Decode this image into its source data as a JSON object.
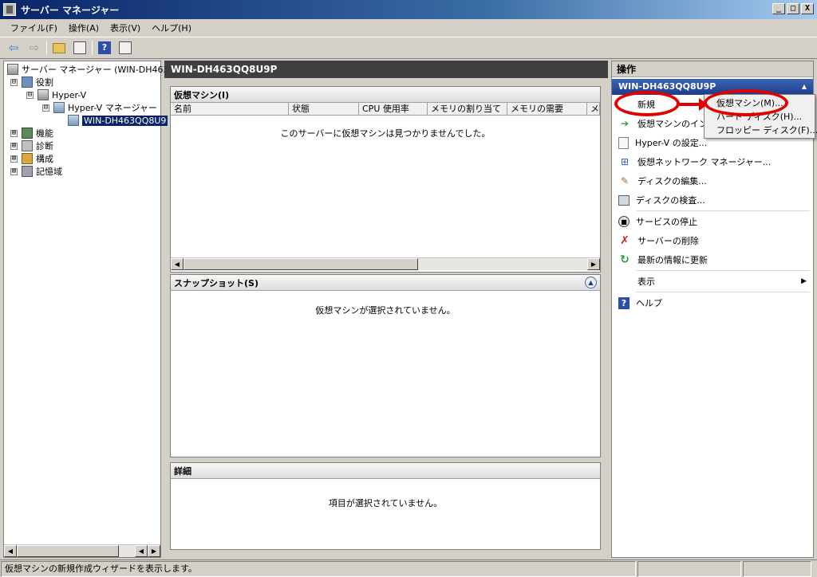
{
  "window": {
    "title": "サーバー マネージャー",
    "min_label": "_",
    "max_label": "□",
    "close_label": "X"
  },
  "menu": [
    "ファイル(F)",
    "操作(A)",
    "表示(V)",
    "ヘルプ(H)"
  ],
  "toolbar": {
    "back": "⇦",
    "forward": "⇨",
    "help": "?"
  },
  "tree": {
    "root": "サーバー マネージャー (WIN-DH463",
    "roles": "役割",
    "hyperv": "Hyper-V",
    "hyperv_manager": "Hyper-V マネージャー",
    "server": "WIN-DH463QQ8U9",
    "features": "機能",
    "diagnostics": "診断",
    "configuration": "構成",
    "storage": "記憶域",
    "expander_minus": "⊟",
    "expander_plus": "⊞"
  },
  "center": {
    "header": "WIN-DH463QQ8U9P",
    "vm_panel": {
      "title": "仮想マシン(I)",
      "columns": [
        "名前",
        "状態",
        "CPU 使用率",
        "メモリの割り当て",
        "メモリの需要",
        "メ"
      ],
      "empty": "このサーバーに仮想マシンは見つかりませんでした。"
    },
    "snapshot_panel": {
      "title": "スナップショット(S)",
      "empty": "仮想マシンが選択されていません。"
    },
    "details_panel": {
      "title": "詳細",
      "empty": "項目が選択されていません。"
    }
  },
  "actions": {
    "title": "操作",
    "group": "WIN-DH463QQ8U9P",
    "new": "新規",
    "import": "仮想マシンのインポート...",
    "hv_settings": "Hyper-V の設定...",
    "vnet_manager": "仮想ネットワーク マネージャー...",
    "edit_disk": "ディスクの編集...",
    "inspect_disk": "ディスクの検査...",
    "stop_service": "サービスの停止",
    "remove_server": "サーバーの削除",
    "refresh": "最新の情報に更新",
    "view": "表示",
    "help": "ヘルプ"
  },
  "popup": [
    "仮想マシン(M)...",
    "ハード ディスク(H)...",
    "フロッピー ディスク(F)..."
  ],
  "status": {
    "text": "仮想マシンの新規作成ウィザードを表示します。"
  },
  "colors": {
    "highlight": "#e00000",
    "accent": "#0a246a"
  }
}
